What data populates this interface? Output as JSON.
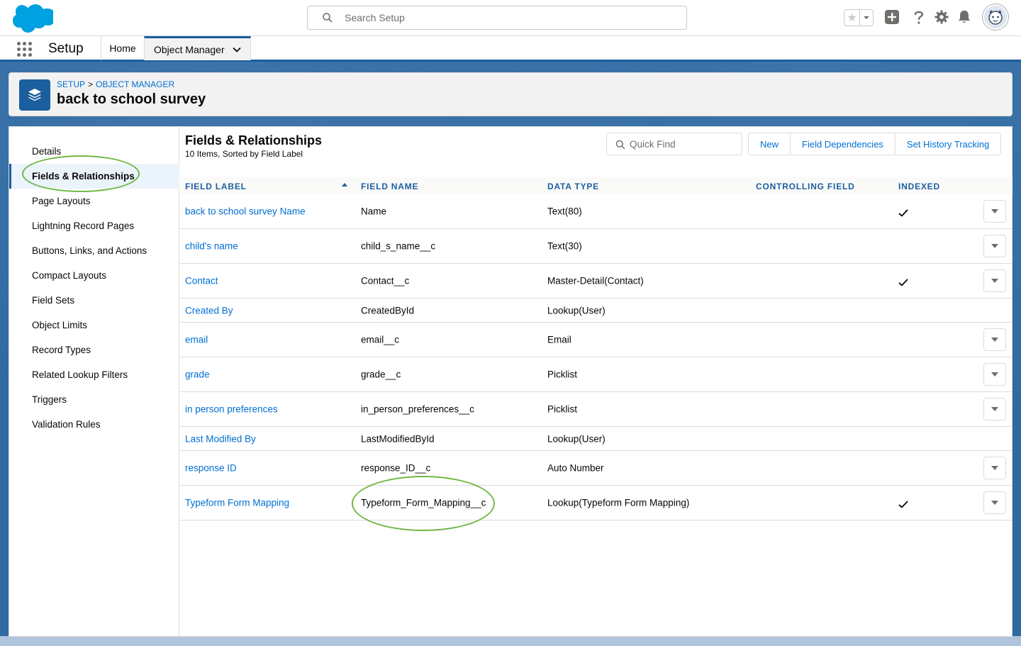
{
  "header": {
    "search_placeholder": "Search Setup",
    "star_glyph": "★"
  },
  "context": {
    "app_name": "Setup",
    "nav_home": "Home",
    "nav_object_manager": "Object Manager"
  },
  "page": {
    "breadcrumb_setup": "SETUP",
    "breadcrumb_sep": ">",
    "breadcrumb_object_manager": "OBJECT MANAGER",
    "title": "back to school survey"
  },
  "sidebar": {
    "items": [
      {
        "label": "Details"
      },
      {
        "label": "Fields & Relationships"
      },
      {
        "label": "Page Layouts"
      },
      {
        "label": "Lightning Record Pages"
      },
      {
        "label": "Buttons, Links, and Actions"
      },
      {
        "label": "Compact Layouts"
      },
      {
        "label": "Field Sets"
      },
      {
        "label": "Object Limits"
      },
      {
        "label": "Record Types"
      },
      {
        "label": "Related Lookup Filters"
      },
      {
        "label": "Triggers"
      },
      {
        "label": "Validation Rules"
      }
    ],
    "active_index": 1
  },
  "section": {
    "title": "Fields & Relationships",
    "subtitle": "10 Items, Sorted by Field Label",
    "quickfind_placeholder": "Quick Find",
    "btn_new": "New",
    "btn_field_dependencies": "Field Dependencies",
    "btn_history": "Set History Tracking"
  },
  "table": {
    "headers": {
      "label": "FIELD LABEL",
      "name": "FIELD NAME",
      "type": "DATA TYPE",
      "controlling": "CONTROLLING FIELD",
      "indexed": "INDEXED"
    },
    "rows": [
      {
        "label": "back to school survey Name",
        "name": "Name",
        "type": "Text(80)",
        "indexed": true,
        "menu": true
      },
      {
        "label": "child's name",
        "name": "child_s_name__c",
        "type": "Text(30)",
        "indexed": false,
        "menu": true
      },
      {
        "label": "Contact",
        "name": "Contact__c",
        "type": "Master-Detail(Contact)",
        "indexed": true,
        "menu": true
      },
      {
        "label": "Created By",
        "name": "CreatedById",
        "type": "Lookup(User)",
        "indexed": false,
        "menu": false
      },
      {
        "label": "email",
        "name": "email__c",
        "type": "Email",
        "indexed": false,
        "menu": true
      },
      {
        "label": "grade",
        "name": "grade__c",
        "type": "Picklist",
        "indexed": false,
        "menu": true
      },
      {
        "label": "in person preferences",
        "name": "in_person_preferences__c",
        "type": "Picklist",
        "indexed": false,
        "menu": true
      },
      {
        "label": "Last Modified By",
        "name": "LastModifiedById",
        "type": "Lookup(User)",
        "indexed": false,
        "menu": false
      },
      {
        "label": "response ID",
        "name": "response_ID__c",
        "type": "Auto Number",
        "indexed": false,
        "menu": true
      },
      {
        "label": "Typeform Form Mapping",
        "name": "Typeform_Form_Mapping__c",
        "type": "Lookup(Typeform Form Mapping)",
        "indexed": true,
        "menu": true
      }
    ]
  },
  "colors": {
    "brand_blue": "#1b5f9e",
    "link_blue": "#0070d2",
    "highlight_green": "#72b845",
    "salesforce_cloud": "#00a1e0"
  }
}
